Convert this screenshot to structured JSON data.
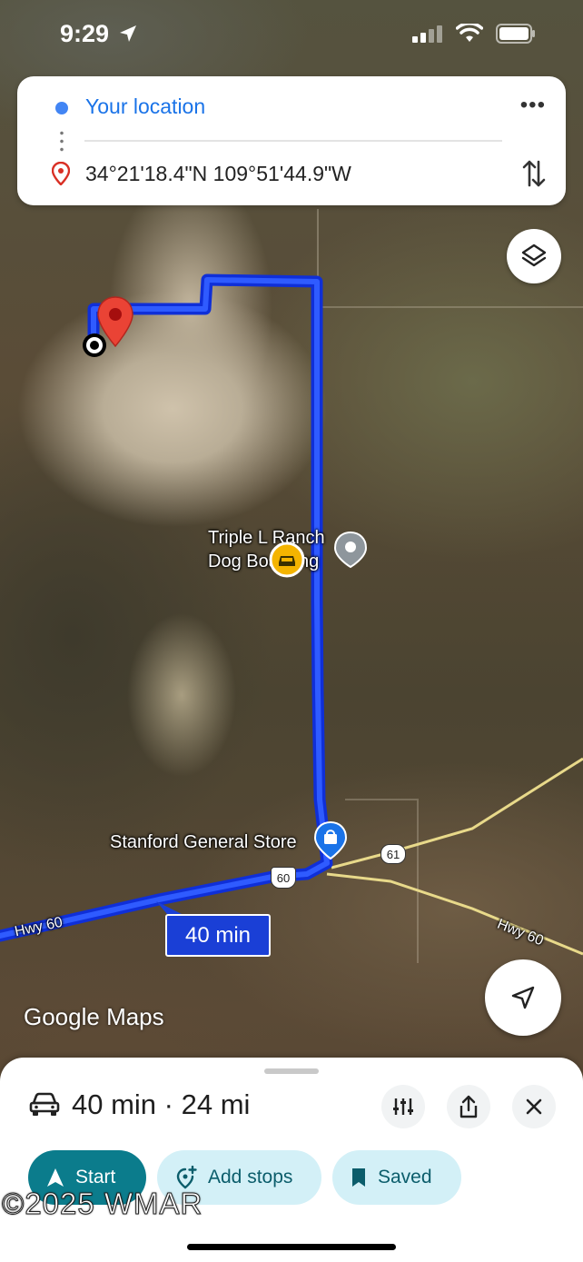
{
  "status_bar": {
    "time": "9:29"
  },
  "directions": {
    "origin": "Your location",
    "destination": "34°21'18.4\"N 109°51'44.9\"W",
    "more_label": "•••"
  },
  "map": {
    "labels": {
      "kennel_line1": "Triple L Ranch",
      "kennel_line2": "Dog Boarding",
      "store": "Stanford General Store",
      "hwy_60_left": "Hwy 60",
      "hwy_60_right": "Hwy 60",
      "shield_60": "60",
      "shield_61": "61"
    },
    "route_time": "40 min",
    "logo": "Google Maps",
    "route_color": "#1a3fd6"
  },
  "bottom_sheet": {
    "trip_summary": "40 min · 24 mi",
    "actions": {
      "start": "Start",
      "add_stops": "Add stops",
      "saved": "Saved"
    }
  },
  "watermark": "©2025 WMAR",
  "icons": [
    "location-arrow-icon",
    "signal-icon",
    "wifi-icon",
    "battery-icon",
    "destination-pin-icon",
    "swap-icon",
    "layers-icon",
    "kennel-pin-icon",
    "traffic-car-icon",
    "shopping-bag-pin-icon",
    "my-location-icon",
    "car-icon",
    "route-options-icon",
    "share-icon",
    "close-icon",
    "navigation-arrow-icon",
    "add-stop-icon",
    "bookmark-icon"
  ]
}
